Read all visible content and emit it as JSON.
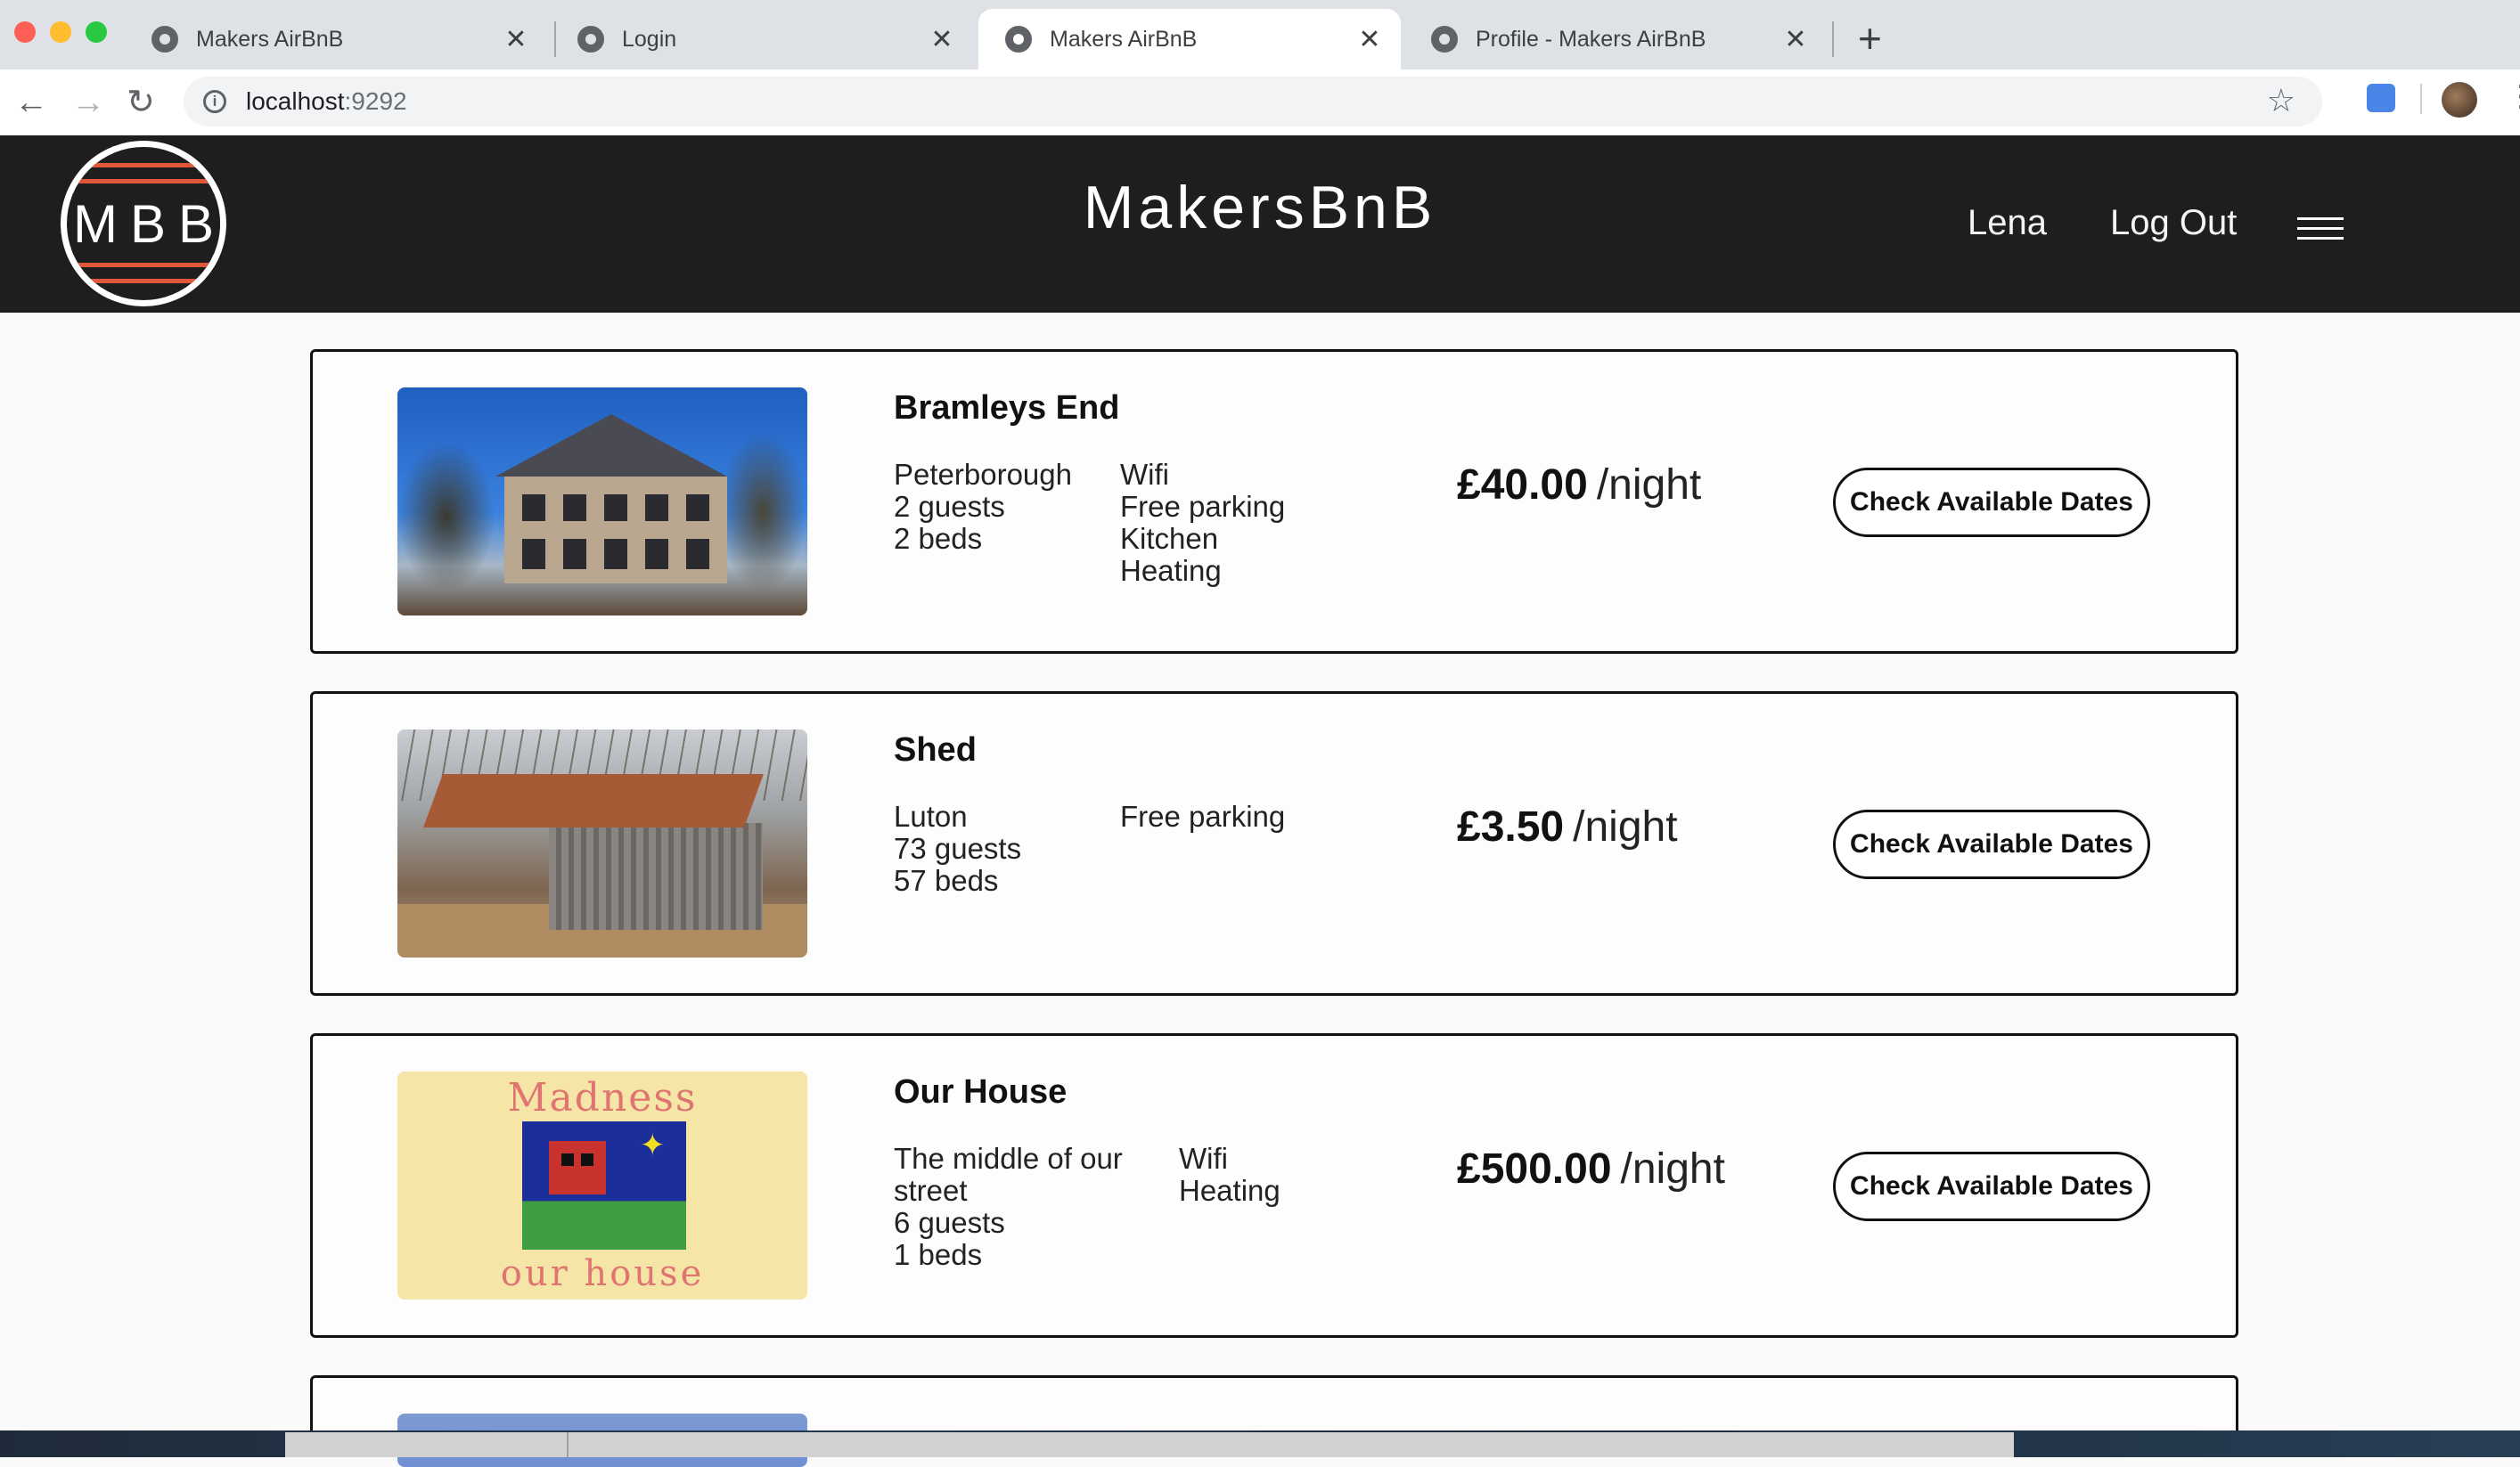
{
  "browser": {
    "tabs": [
      {
        "title": "Makers AirBnB",
        "active": false
      },
      {
        "title": "Login",
        "active": false
      },
      {
        "title": "Makers AirBnB",
        "active": true
      },
      {
        "title": "Profile - Makers AirBnB",
        "active": false
      }
    ],
    "close_glyph": "✕",
    "new_tab_glyph": "+",
    "url_host": "localhost",
    "url_port": ":9292",
    "icons": [
      "back-arrow-icon",
      "forward-arrow-icon",
      "reload-icon",
      "info-icon",
      "star-icon",
      "extension-icon",
      "profile-avatar",
      "more-icon"
    ]
  },
  "header": {
    "logo_text": "MBB",
    "title": "MakersBnB",
    "user_link": "Lena",
    "logout_link": "Log Out",
    "menu_icon": "hamburger-menu-icon"
  },
  "listings": [
    {
      "name": "Bramleys End",
      "location": "Peterborough",
      "guests": "2 guests",
      "beds": "2 beds",
      "amenities": [
        "Wifi",
        "Free parking",
        "Kitchen",
        "Heating"
      ],
      "price": "£40.00",
      "price_unit": "/night",
      "button": "Check Available Dates",
      "photo": "house-photo"
    },
    {
      "name": "Shed",
      "location": "Luton",
      "guests": "73 guests",
      "beds": "57 beds",
      "amenities": [
        "Free parking"
      ],
      "price": "£3.50",
      "price_unit": "/night",
      "button": "Check Available Dates",
      "photo": "shed-photo"
    },
    {
      "name": "Our House",
      "location_line1": "The middle of our",
      "location_line2": "street",
      "guests": "6 guests",
      "beds": "1 beds",
      "amenities": [
        "Wifi",
        "Heating"
      ],
      "price": "£500.00",
      "price_unit": "/night",
      "button": "Check Available Dates",
      "photo": "album-cover-photo",
      "photo_text_top": "Madness",
      "photo_text_bottom": "our house"
    }
  ],
  "colors": {
    "header_bg": "#1e1e1e",
    "logo_accent": "#e0573a",
    "page_bg": "#fafafa",
    "border": "#111111"
  }
}
